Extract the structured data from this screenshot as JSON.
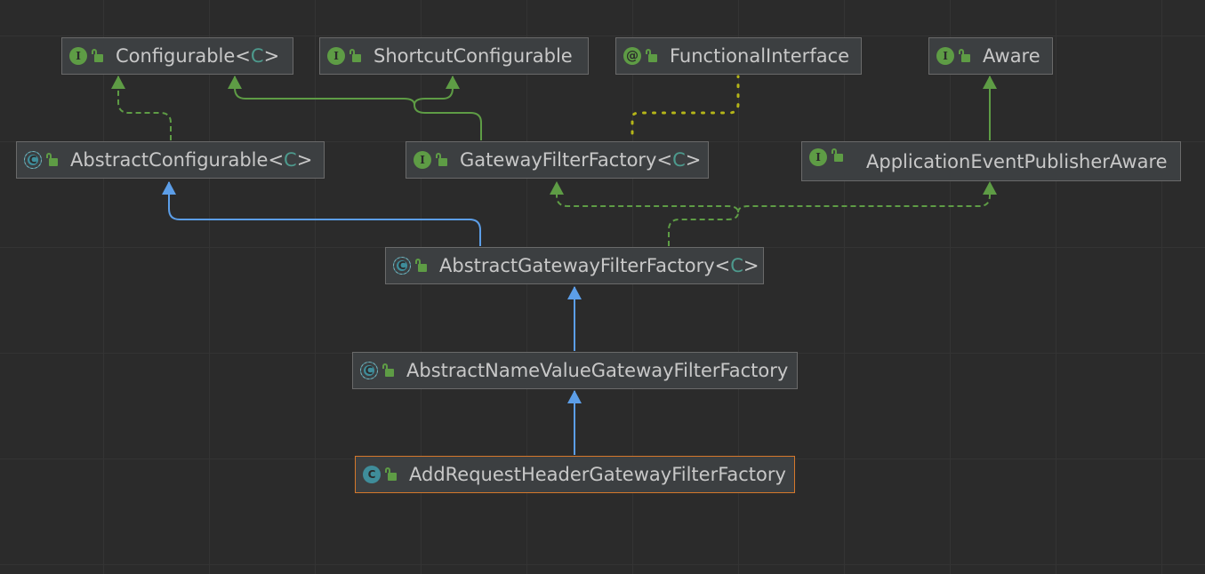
{
  "diagram": {
    "nodes": [
      {
        "id": "configurable",
        "kind": "interface",
        "kind_glyph": "I",
        "name": "Configurable",
        "type_param": "C"
      },
      {
        "id": "shortcut",
        "kind": "interface",
        "kind_glyph": "I",
        "name": "ShortcutConfigurable",
        "type_param": ""
      },
      {
        "id": "functional",
        "kind": "annotation",
        "kind_glyph": "@",
        "name": "FunctionalInterface",
        "type_param": ""
      },
      {
        "id": "aware",
        "kind": "interface",
        "kind_glyph": "I",
        "name": "Aware",
        "type_param": ""
      },
      {
        "id": "abstract_configurable",
        "kind": "abstract",
        "kind_glyph": "C",
        "name": "AbstractConfigurable",
        "type_param": "C"
      },
      {
        "id": "gateway_filter_factory",
        "kind": "interface",
        "kind_glyph": "I",
        "name": "GatewayFilterFactory",
        "type_param": "C"
      },
      {
        "id": "app_event_publisher_aware",
        "kind": "interface",
        "kind_glyph": "I",
        "name": "ApplicationEventPublisherAware",
        "type_param": ""
      },
      {
        "id": "abstract_gateway_filter_factory",
        "kind": "abstract",
        "kind_glyph": "C",
        "name": "AbstractGatewayFilterFactory",
        "type_param": "C"
      },
      {
        "id": "abstract_name_value",
        "kind": "abstract",
        "kind_glyph": "C",
        "name": "AbstractNameValueGatewayFilterFactory",
        "type_param": ""
      },
      {
        "id": "add_request_header",
        "kind": "class",
        "kind_glyph": "C",
        "name": "AddRequestHeaderGatewayFilterFactory",
        "type_param": "",
        "selected": true
      }
    ],
    "edges": [
      {
        "from": "abstract_configurable",
        "to": "configurable",
        "relation": "implements"
      },
      {
        "from": "gateway_filter_factory",
        "to": "configurable",
        "relation": "extends-interface"
      },
      {
        "from": "gateway_filter_factory",
        "to": "shortcut",
        "relation": "extends-interface"
      },
      {
        "from": "gateway_filter_factory",
        "to": "functional",
        "relation": "annotated"
      },
      {
        "from": "app_event_publisher_aware",
        "to": "aware",
        "relation": "extends-interface"
      },
      {
        "from": "abstract_gateway_filter_factory",
        "to": "abstract_configurable",
        "relation": "extends"
      },
      {
        "from": "abstract_gateway_filter_factory",
        "to": "gateway_filter_factory",
        "relation": "implements"
      },
      {
        "from": "abstract_gateway_filter_factory",
        "to": "app_event_publisher_aware",
        "relation": "implements"
      },
      {
        "from": "abstract_name_value",
        "to": "abstract_gateway_filter_factory",
        "relation": "extends"
      },
      {
        "from": "add_request_header",
        "to": "abstract_name_value",
        "relation": "extends"
      }
    ],
    "colors": {
      "background": "#2b2b2b",
      "node_fill": "#3c3f41",
      "node_border": "#6a6a6a",
      "selected_border": "#d5782b",
      "extends_edge": "#5c9ee8",
      "implements_edge": "#5e9c45",
      "annotation_edge": "#b5b518",
      "type_param": "#4d9a8d"
    }
  }
}
